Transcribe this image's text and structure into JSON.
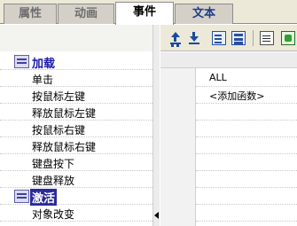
{
  "tabs": [
    {
      "label": "属性",
      "active": false
    },
    {
      "label": "动画",
      "active": false
    },
    {
      "label": "事件",
      "active": true
    },
    {
      "label": "文本",
      "active": false
    }
  ],
  "tree": {
    "categories": [
      {
        "label": "加载",
        "events": [
          "单击",
          "按鼠标左键",
          "释放鼠标左键",
          "按鼠标右键",
          "释放鼠标右键",
          "键盘按下",
          "键盘释放"
        ]
      },
      {
        "label": "激活",
        "events": [
          "对象改变"
        ]
      }
    ]
  },
  "toolbar": {
    "icons": [
      "move-up-icon",
      "move-down-icon",
      "expand-all-icon",
      "collapse-all-icon",
      "script-icon",
      "green-script-icon"
    ]
  },
  "function_list": {
    "rows": [
      "ALL",
      "<添加函数>"
    ]
  },
  "colors": {
    "category_text": "#1a1aa8",
    "selected_bg": "#2a2a9a",
    "toolbar_bg": "#ece9d8"
  }
}
